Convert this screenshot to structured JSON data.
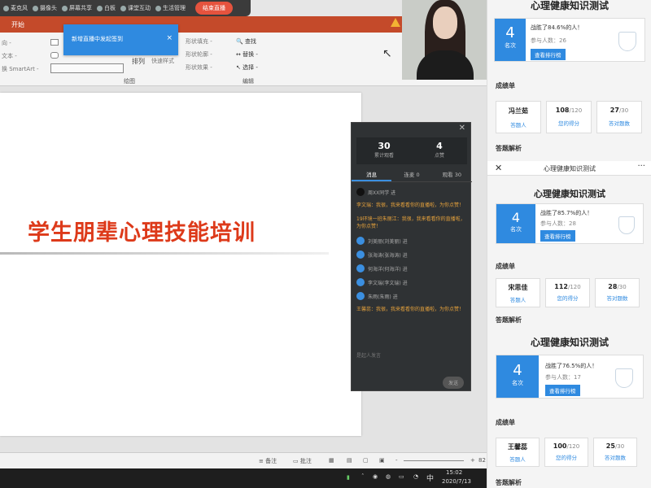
{
  "live_toolbar": {
    "items": [
      "麦克风",
      "摄像头",
      "屏幕共享",
      "白板",
      "课堂互动",
      "生活管理"
    ],
    "end_button": "结束直播"
  },
  "ribbon": {
    "tab": "开始",
    "notification": "新增直播中发起签到",
    "left_labels": [
      "向 -",
      "文本 -",
      "换 SmartArt -"
    ],
    "drawing_labels": [
      "排列",
      "快速样式",
      "形状填充 -",
      "形状轮廓 -",
      "形状效果 -"
    ],
    "group_drawing": "绘图",
    "edit_items": [
      "查找",
      "替换 -",
      "选择 -"
    ],
    "group_edit": "编辑"
  },
  "slide": {
    "title": "学生朋辈心理技能培训"
  },
  "chat": {
    "stats": [
      {
        "value": "30",
        "label": "累计观看"
      },
      {
        "value": "4",
        "label": "点赞"
      }
    ],
    "tabs": [
      "消息",
      "连麦 0",
      "观看 30"
    ],
    "messages": [
      {
        "type": "user",
        "text": "周XX同学 进"
      },
      {
        "type": "notice",
        "text": "李文瑞：我很，我来看看你的直播啦，为你点赞！"
      },
      {
        "type": "notice",
        "text": "19环境一班朱丽江：我很，我来看看你的直播啦，为你点赞！"
      },
      {
        "type": "user",
        "text": "刘美丽(刘美丽) 进"
      },
      {
        "type": "user",
        "text": "张海涛(张海涛) 进"
      },
      {
        "type": "user",
        "text": "何海洋(何海洋) 进"
      },
      {
        "type": "user",
        "text": "李文瑞(李文瑞) 进"
      },
      {
        "type": "user",
        "text": "朱雨(朱雨) 进"
      },
      {
        "type": "notice",
        "text": "王馨蕊：我很，我来看看你的直播啦，为你点赞！"
      }
    ],
    "input_placeholder": "是起人发言",
    "send": "发送"
  },
  "statusbar": {
    "notes": "备注",
    "comments": "批注",
    "zoom": "82"
  },
  "taskbar": {
    "ime": "中",
    "time": "15:02",
    "date": "2020/7/13"
  },
  "quiz": {
    "title": "心理健康知识测试",
    "nav_title": "心理健康知识测试",
    "rank_unit": "名次",
    "leaderboard_btn": "查看排行榜",
    "section_scores": "成绩单",
    "section_analysis": "答题解析",
    "score_labels": [
      "答题人",
      "您的得分",
      "答对题数"
    ],
    "results": [
      {
        "rank": "4",
        "beat": "战胜了84.6%的人！",
        "participants": "参与人数：26",
        "name": "冯兰茹",
        "score": "108",
        "score_total": "/120",
        "correct": "27",
        "correct_total": "/30"
      },
      {
        "rank": "4",
        "beat": "战胜了85.7%的人！",
        "participants": "参与人数：28",
        "name": "宋思佳",
        "score": "112",
        "score_total": "/120",
        "correct": "28",
        "correct_total": "/30"
      },
      {
        "rank": "4",
        "beat": "战胜了76.5%的人！",
        "participants": "参与人数：17",
        "name": "王馨蕊",
        "score": "100",
        "score_total": "/120",
        "correct": "25",
        "correct_total": "/30"
      }
    ]
  },
  "colors": {
    "accent_blue": "#2f8ae0",
    "slide_red": "#dd3a1a",
    "end_live": "#e5533e",
    "ribbon": "#c44a2a"
  }
}
